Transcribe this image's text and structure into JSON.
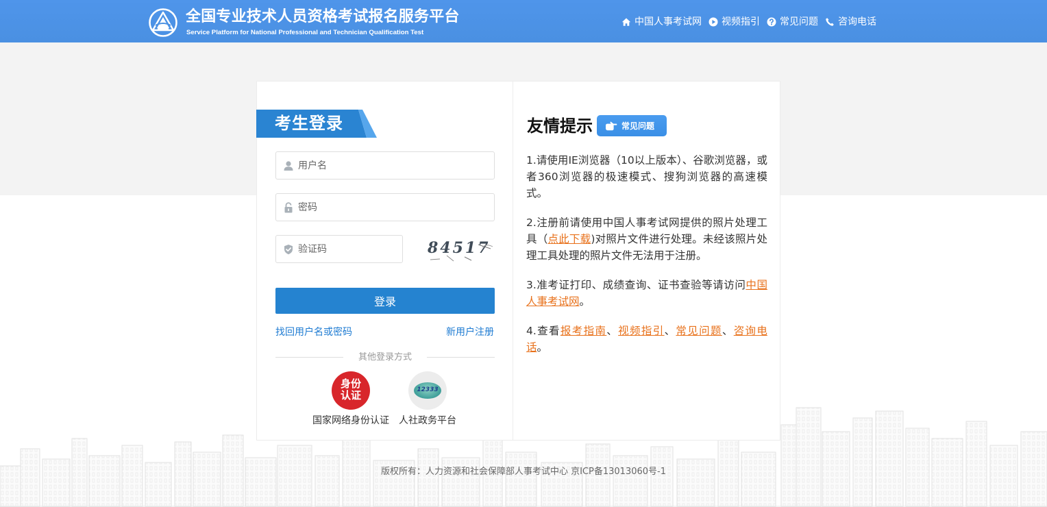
{
  "theme": {
    "primary": "#4a90e2",
    "tab": "#2a84d2",
    "tab-light": "#56a6ec",
    "button": "#2583d0",
    "link": "#1e7bd2",
    "hilite": "#e8711b",
    "badge": "#3a8fe6",
    "red": "#d8262b"
  },
  "header": {
    "title": "全国专业技术人员资格考试报名服务平台",
    "subtitle": "Service Platform for National Professional and Technician Qualification Test",
    "logo_icon": "pta-triangle-logo",
    "nav": [
      {
        "label": "中国人事考试网",
        "icon": "home-icon"
      },
      {
        "label": "视频指引",
        "icon": "play-icon"
      },
      {
        "label": "常见问题",
        "icon": "question-icon"
      },
      {
        "label": "咨询电话",
        "icon": "phone-icon"
      }
    ]
  },
  "login": {
    "title": "考生登录",
    "username": {
      "placeholder": "用户名",
      "icon": "user-icon"
    },
    "password": {
      "placeholder": "密码",
      "icon": "lock-icon"
    },
    "captcha": {
      "placeholder": "验证码",
      "icon": "shield-icon",
      "image_text": "84517"
    },
    "submit_label": "登录",
    "forgot_link": "找回用户名或密码",
    "register_link": "新用户注册",
    "other_methods_label": "其他登录方式",
    "methods": [
      {
        "label": "国家网络身份认证",
        "icon_lines": [
          "身份",
          "认证"
        ]
      },
      {
        "label": "人社政务平台",
        "icon_text": "12333"
      }
    ]
  },
  "tips": {
    "title": "友情提示",
    "faq_button": "常见问题",
    "faq_icon": "pointing-hand-icon",
    "items": [
      {
        "parts": [
          {
            "text": "1.请使用IE浏览器（10以上版本）、谷歌浏览器，或者360浏览器的极速模式、搜狗浏览器的高速模式。"
          }
        ]
      },
      {
        "parts": [
          {
            "text": "2.注册前请使用中国人事考试网提供的照片处理工具（"
          },
          {
            "text": "点此下载",
            "link": true
          },
          {
            "text": ")对照片文件进行处理。未经该照片处理工具处理的照片文件无法用于注册。"
          }
        ]
      },
      {
        "parts": [
          {
            "text": "3.准考证打印、成绩查询、证书查验等请访问"
          },
          {
            "text": "中国人事考试网",
            "link": true
          },
          {
            "text": "。"
          }
        ]
      },
      {
        "parts": [
          {
            "text": "4.查看"
          },
          {
            "text": "报考指南",
            "link": true
          },
          {
            "text": "、"
          },
          {
            "text": "视频指引",
            "link": true
          },
          {
            "text": "、"
          },
          {
            "text": "常见问题",
            "link": true
          },
          {
            "text": "、"
          },
          {
            "text": "咨询电话",
            "link": true
          },
          {
            "text": "。"
          }
        ]
      }
    ]
  },
  "footer": {
    "copyright": "版权所有：人力资源和社会保障部人事考试中心 京ICP备13013060号-1"
  }
}
